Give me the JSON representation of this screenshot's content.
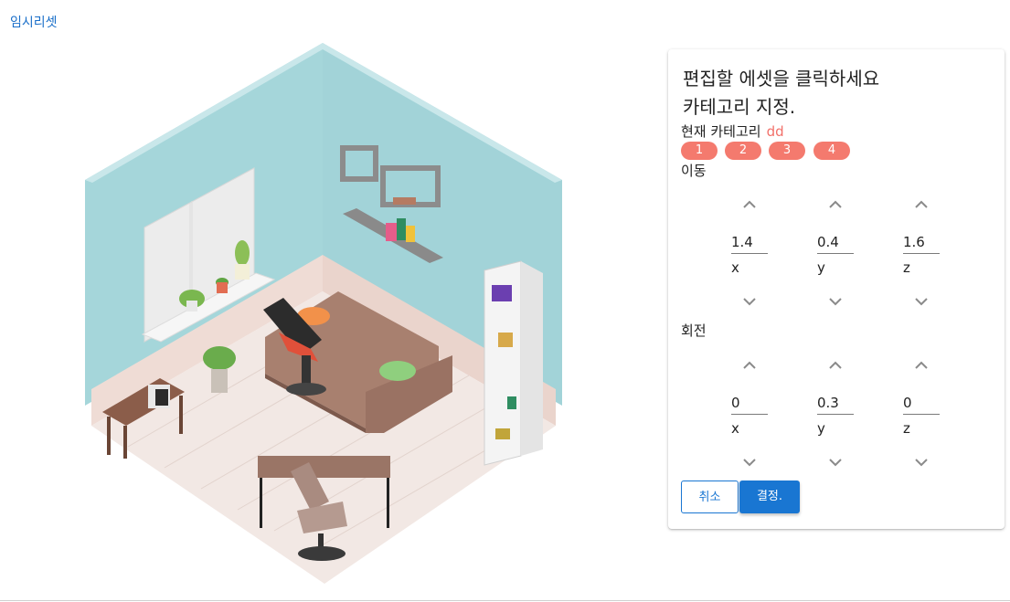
{
  "header": {
    "reset_link": "임시리셋"
  },
  "panel": {
    "title": "편집할 에셋을 클릭하세요",
    "subtitle": "카테고리 지정.",
    "category_label": "현재 카테고리",
    "category_value": "dd",
    "chips": [
      "1",
      "2",
      "3",
      "4"
    ],
    "move": {
      "label": "이동",
      "fields": [
        {
          "value": "1.4",
          "axis": "x"
        },
        {
          "value": "0.4",
          "axis": "y"
        },
        {
          "value": "1.6",
          "axis": "z"
        }
      ]
    },
    "rotate": {
      "label": "회전",
      "fields": [
        {
          "value": "0",
          "axis": "x"
        },
        {
          "value": "0.3",
          "axis": "y"
        },
        {
          "value": "0",
          "axis": "z"
        }
      ]
    },
    "cancel_label": "취소",
    "ok_label": "결정."
  },
  "colors": {
    "accent": "#1976d2",
    "chip": "#f47a6e",
    "category": "#f2706a",
    "wall": "#a5d6da",
    "floor": "#f1e6e1",
    "sofa": "#a47c6d"
  }
}
